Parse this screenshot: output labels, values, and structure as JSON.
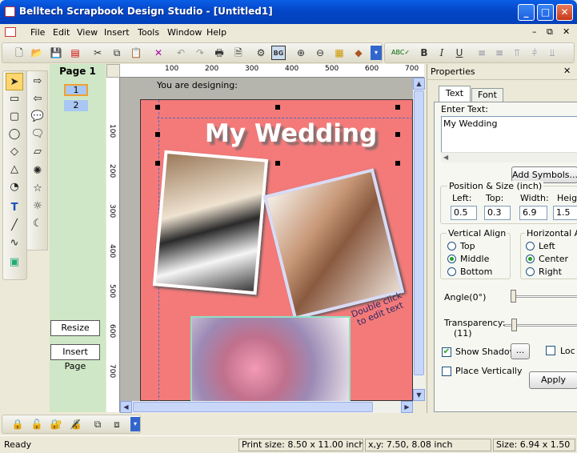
{
  "window": {
    "title": "Belltech Scrapbook Design Studio - [Untitled1]"
  },
  "menu": [
    "File",
    "Edit",
    "View",
    "Insert",
    "Tools",
    "Window",
    "Help"
  ],
  "pages_panel": {
    "title": "Page 1",
    "pages": [
      "1",
      "2"
    ],
    "resize": "Resize",
    "insert_page": "Insert Page"
  },
  "canvas": {
    "designing_label": "You are designing:",
    "heading": "My Wedding",
    "caption": "Double click to edit text",
    "ruler_top": [
      "100",
      "200",
      "300",
      "400",
      "500",
      "600",
      "700"
    ],
    "ruler_left": [
      "100",
      "200",
      "300",
      "400",
      "500",
      "600",
      "700"
    ]
  },
  "properties": {
    "title": "Properties",
    "tabs": [
      "Text",
      "Font"
    ],
    "enter_text_label": "Enter Text:",
    "text_value": "My Wedding",
    "add_symbols": "Add Symbols...",
    "pos_size_label": "Position & Size (inch)",
    "left_label": "Left:",
    "top_label": "Top:",
    "width_label": "Width:",
    "height_label": "Heigh",
    "left": "0.5",
    "top": "0.3",
    "width": "6.9",
    "height": "1.5",
    "valign_label": "Vertical Align",
    "valign": [
      "Top",
      "Middle",
      "Bottom"
    ],
    "halign_label": "Horizontal Al",
    "halign": [
      "Left",
      "Center",
      "Right"
    ],
    "angle_label": "Angle(0°)",
    "transparency_label": "Transparency:",
    "transparency_value": "(11)",
    "show_shadow": "Show Shadow",
    "more_button": "...",
    "lock": "Loc",
    "place_vertically": "Place Vertically",
    "apply": "Apply"
  },
  "status": {
    "ready": "Ready",
    "print_size": "Print size: 8.50 x 11.00 inch",
    "xy": "x,y: 7.50, 8.08 inch",
    "size": "Size: 6.94 x 1.50"
  }
}
